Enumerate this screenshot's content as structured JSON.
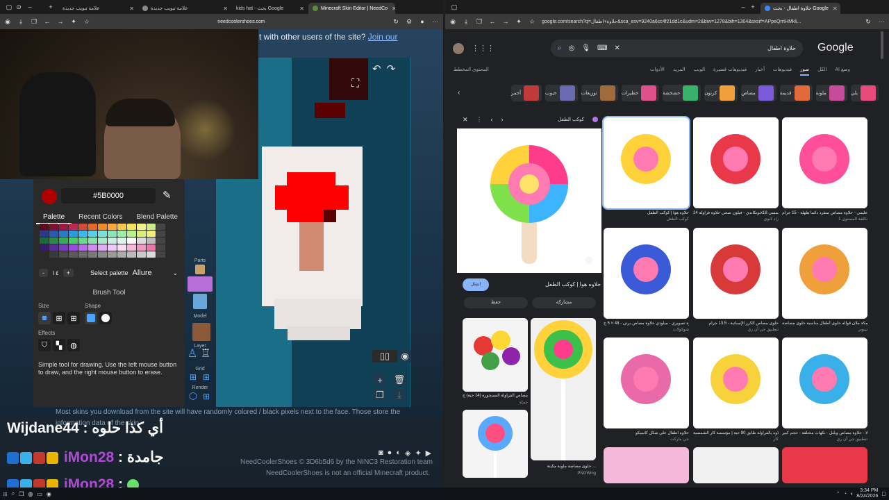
{
  "left_window": {
    "tabs": [
      {
        "label": "علامة تبويب جديدة"
      },
      {
        "label": "علامة تبويب جديدة"
      },
      {
        "label": "kids hat - بحث Google"
      },
      {
        "label": "Minecraft Skin Editor | NeedCo"
      }
    ],
    "url": "needcoolershoes.com",
    "notice_text": "t with other users of the site?",
    "notice_link": "Join our",
    "color_hex": "#5B0000",
    "palette_tabs": [
      "Palette",
      "Recent Colors",
      "Blend Palette"
    ],
    "palette_count": "١٤",
    "select_palette_label": "Select palette",
    "select_palette_value": "Allure",
    "brush_title": "Brush Tool",
    "size_label": "Size",
    "shape_label": "Shape",
    "effects_label": "Effects",
    "description": "Simple tool for drawing. Use the left mouse button to draw, and the right mouse button to erase.",
    "sidebar_labels": {
      "parts": "Parts",
      "model": "Model",
      "layer": "Layer",
      "grid": "Grid",
      "render": "Render"
    },
    "bottom_notice": "Most skins you download from the site will have randomly colored / black pixels next to the face. Those store the",
    "bottom_notice2": "information data of the skin.",
    "credits_line": "NeedCoolerShoes © 3D6b5d6 by the NINC3 Restoration team",
    "credits_line2": "NeedCoolerShoes is not an official Minecraft product.",
    "chat": [
      {
        "user": "Wijdane44",
        "message": "أي كذا حلوه"
      },
      {
        "user": "iMon28",
        "message": "جامدة"
      },
      {
        "user": "iMon28",
        "message": ""
      }
    ]
  },
  "right_window": {
    "tab_label": "حلاوة اطفال - بحث Google",
    "url": "google.com/search?q=حلاوة+اطفال&sca_esv=9240a6cc4f21dd1c&udm=2&biw=1278&bih=1304&sxsrf=APpeQrrtHMkli...",
    "query": "حلاوة اطفال",
    "logo": "Google",
    "nav": [
      "وضع AI",
      "الكل",
      "صور",
      "فيديوهات",
      "أخبار",
      "فيديوهات قصيرة",
      "الويب",
      "المزيد",
      "الأدوات"
    ],
    "safe_search": "المحتوى المخطط",
    "chips": [
      "بلي",
      "ملونة",
      "قديمة",
      "مصاص",
      "كرتون",
      "خشخشة",
      "خطيرات",
      "توزيعات",
      "حبوب",
      "أحمر"
    ],
    "preview": {
      "source": "كوكب الطفل",
      "title": "حلاوه هوا | كوكب الطفل",
      "visit": "انتقال",
      "share": "مشاركة",
      "save": "حفظ"
    },
    "results": [
      {
        "caption": "حلاوه هوا | كوكب الطفل",
        "source": "كوكب الطفل"
      },
      {
        "caption": "بونكاندي - فيلون صحي حلاوة فراولة 24x18 جرام | زاد الشمسي",
        "source": "زاد كنوي"
      },
      {
        "caption": "حلاوة عليمي - حلاوة مصاص منفرد دائماً هلهلة - 15 جرام",
        "source": "تكلفة المستوى 1"
      },
      {
        "caption": "حلاوة تصويري - ميلودي حلاوة مصاص برتي - 48 × 5 ج...",
        "source": "شوكولات"
      },
      {
        "caption": "حلوى مصاص الكرز الإسبانية - 13.5 جرام",
        "source": "تتطبيق جي أن ري"
      },
      {
        "caption": "حلويات بمكة ملان قواله حلوى أطفال مناسبة حلوى مصاصة...",
        "source": "سوبر"
      },
      {
        "caption": "حلاوه اطفال علي شكل كاسيكو",
        "source": "جي ماركت"
      },
      {
        "caption": "حلاوه بالفراولة طابق 80 حبة | مؤسسة كار الشمسية",
        "source": "كار"
      },
      {
        "caption": "شيكولا - حلاوة مصاص وبلبل - نكهات مختلفة - حجم كبير ...",
        "source": "تتطبيق جي أن ري"
      }
    ],
    "preview_related": [
      {
        "caption": "حلوى مصاص الفراولة المسحورة (14 حبة) ج ...",
        "source": "جملة"
      },
      {
        "caption": "حلوى مصاصة ملونة مكينة ...",
        "source": "PNGWing"
      }
    ]
  },
  "taskbar": {
    "time": "3:34 PM",
    "date": "8/24/2026"
  },
  "colors": {
    "accent_red": "#ff0000",
    "dark_red": "#5b0000",
    "viewport_teal": "#1a6e87",
    "link_blue": "#8ab4f8"
  }
}
